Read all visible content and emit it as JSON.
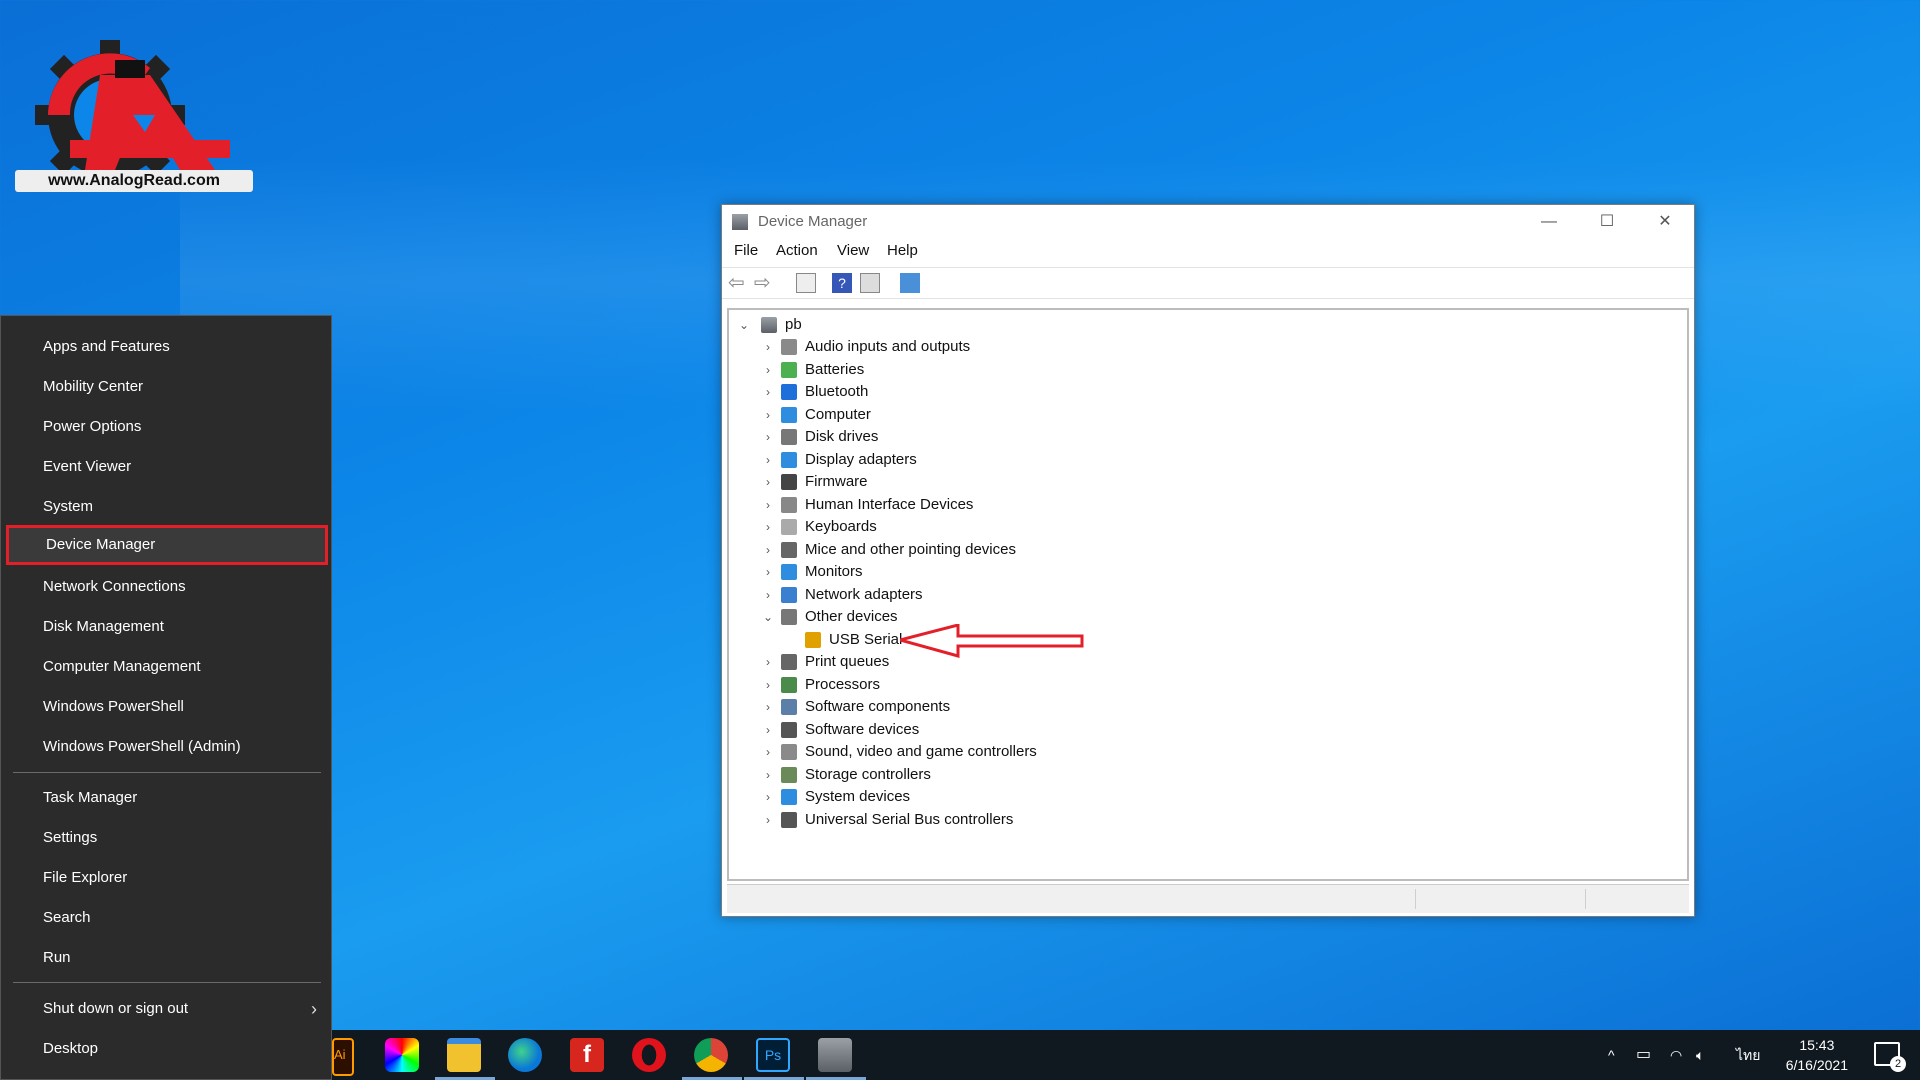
{
  "watermark": {
    "text": "www.AnalogRead.com"
  },
  "winx_menu": {
    "groups": [
      [
        "Apps and Features",
        "Mobility Center",
        "Power Options",
        "Event Viewer",
        "System",
        "Device Manager",
        "Network Connections",
        "Disk Management",
        "Computer Management",
        "Windows PowerShell",
        "Windows PowerShell (Admin)"
      ],
      [
        "Task Manager",
        "Settings",
        "File Explorer",
        "Search",
        "Run"
      ],
      [
        "Shut down or sign out",
        "Desktop"
      ]
    ],
    "selected": "Device Manager",
    "highlight_color": "#e3202a"
  },
  "device_manager": {
    "title": "Device Manager",
    "menu": [
      "File",
      "Action",
      "View",
      "Help"
    ],
    "tree": {
      "root": "pb",
      "categories": [
        {
          "label": "Audio inputs and outputs",
          "icon": "speaker-icon",
          "expanded": false
        },
        {
          "label": "Batteries",
          "icon": "battery-icon",
          "expanded": false
        },
        {
          "label": "Bluetooth",
          "icon": "bluetooth-icon",
          "expanded": false
        },
        {
          "label": "Computer",
          "icon": "computer-icon",
          "expanded": false
        },
        {
          "label": "Disk drives",
          "icon": "disk-icon",
          "expanded": false
        },
        {
          "label": "Display adapters",
          "icon": "display-icon",
          "expanded": false
        },
        {
          "label": "Firmware",
          "icon": "firmware-icon",
          "expanded": false
        },
        {
          "label": "Human Interface Devices",
          "icon": "hid-icon",
          "expanded": false
        },
        {
          "label": "Keyboards",
          "icon": "keyboard-icon",
          "expanded": false
        },
        {
          "label": "Mice and other pointing devices",
          "icon": "mouse-icon",
          "expanded": false
        },
        {
          "label": "Monitors",
          "icon": "monitor-icon",
          "expanded": false
        },
        {
          "label": "Network adapters",
          "icon": "network-icon",
          "expanded": false
        },
        {
          "label": "Other devices",
          "icon": "unknown-device-icon",
          "expanded": true,
          "children": [
            {
              "label": "USB Serial",
              "icon": "warning-device-icon"
            }
          ]
        },
        {
          "label": "Print queues",
          "icon": "printer-icon",
          "expanded": false
        },
        {
          "label": "Processors",
          "icon": "processor-icon",
          "expanded": false
        },
        {
          "label": "Software components",
          "icon": "software-component-icon",
          "expanded": false
        },
        {
          "label": "Software devices",
          "icon": "software-device-icon",
          "expanded": false
        },
        {
          "label": "Sound, video and game controllers",
          "icon": "sound-icon",
          "expanded": false
        },
        {
          "label": "Storage controllers",
          "icon": "storage-icon",
          "expanded": false
        },
        {
          "label": "System devices",
          "icon": "system-icon",
          "expanded": false
        },
        {
          "label": "Universal Serial Bus controllers",
          "icon": "usb-icon",
          "expanded": false
        }
      ]
    }
  },
  "taskbar": {
    "apps": [
      "illustrator-icon",
      "color-wheel-icon",
      "file-explorer-icon",
      "edge-icon",
      "foxit-icon",
      "opera-icon",
      "chrome-icon",
      "photoshop-icon",
      "device-manager-icon"
    ],
    "language": "ไทย",
    "time": "15:43",
    "date": "6/16/2021",
    "notification_count": "2"
  }
}
